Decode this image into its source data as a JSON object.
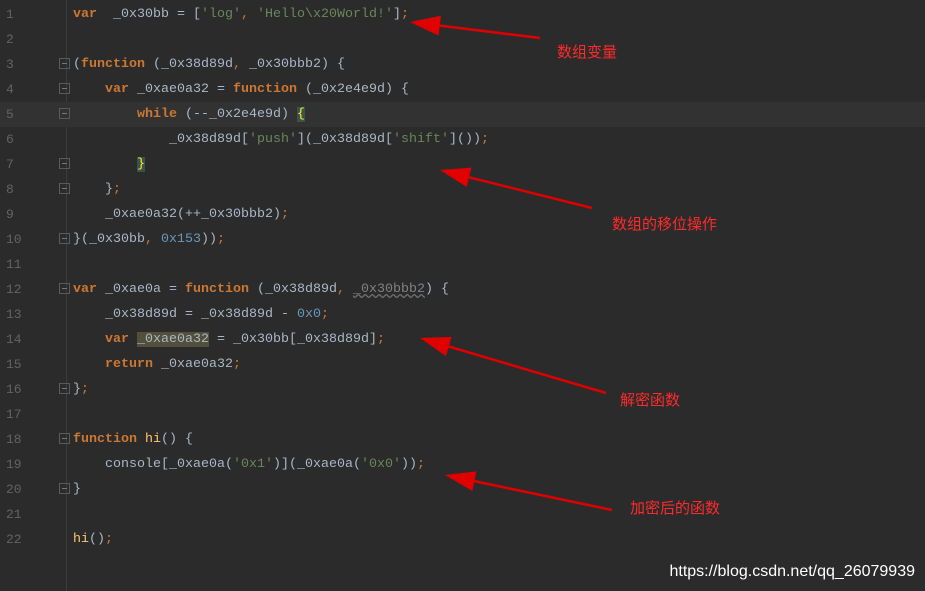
{
  "editor": {
    "current_line": 5,
    "lines": [
      {
        "n": "1",
        "indent": 0,
        "fold": false,
        "tokens": [
          [
            "kw",
            "var"
          ],
          [
            "",
            "  _0x30bb = ["
          ],
          [
            "str",
            "'log'"
          ],
          [
            "punc",
            ","
          ],
          [
            "",
            ""
          ],
          [
            "str",
            " 'Hello\\x20World!'"
          ],
          [
            "",
            "]"
          ],
          [
            "punc",
            ";"
          ]
        ]
      },
      {
        "n": "2",
        "indent": 0,
        "fold": false,
        "tokens": []
      },
      {
        "n": "3",
        "indent": 0,
        "fold": true,
        "tokens": [
          [
            "",
            "("
          ],
          [
            "kw",
            "function"
          ],
          [
            "",
            " (_0x38d89d"
          ],
          [
            "punc",
            ","
          ],
          [
            "",
            " _0x30bbb2) {"
          ]
        ]
      },
      {
        "n": "4",
        "indent": 4,
        "fold": true,
        "tokens": [
          [
            "kw",
            "var"
          ],
          [
            "",
            " _0xae0a32 = "
          ],
          [
            "kw",
            "function"
          ],
          [
            "",
            " (_0x2e4e9d) {"
          ]
        ]
      },
      {
        "n": "5",
        "indent": 8,
        "fold": true,
        "tokens": [
          [
            "kw",
            "while"
          ],
          [
            "",
            " (--_0x2e4e9d) "
          ],
          [
            "brace",
            "{"
          ]
        ]
      },
      {
        "n": "6",
        "indent": 12,
        "fold": false,
        "tokens": [
          [
            "",
            "_0x38d89d["
          ],
          [
            "str",
            "'push'"
          ],
          [
            "",
            "](_0x38d89d["
          ],
          [
            "str",
            "'shift'"
          ],
          [
            "",
            "]())"
          ],
          [
            "punc",
            ";"
          ]
        ]
      },
      {
        "n": "7",
        "indent": 8,
        "fold": true,
        "tokens": [
          [
            "brace",
            "}"
          ]
        ]
      },
      {
        "n": "8",
        "indent": 4,
        "fold": true,
        "tokens": [
          [
            "",
            "}"
          ],
          [
            "punc",
            ";"
          ]
        ]
      },
      {
        "n": "9",
        "indent": 4,
        "fold": false,
        "tokens": [
          [
            "",
            "_0xae0a32(++_0x30bbb2)"
          ],
          [
            "punc",
            ";"
          ]
        ]
      },
      {
        "n": "10",
        "indent": 0,
        "fold": true,
        "tokens": [
          [
            "",
            "}(_0x30bb"
          ],
          [
            "punc",
            ","
          ],
          [
            "num",
            " 0x153"
          ],
          [
            "",
            "))"
          ],
          [
            "punc",
            ";"
          ]
        ]
      },
      {
        "n": "11",
        "indent": 0,
        "fold": false,
        "tokens": []
      },
      {
        "n": "12",
        "indent": 0,
        "fold": true,
        "tokens": [
          [
            "kw",
            "var"
          ],
          [
            "",
            " _0xae0a = "
          ],
          [
            "kw",
            "function"
          ],
          [
            "",
            " (_0x38d89d"
          ],
          [
            "punc",
            ","
          ],
          [
            "",
            " "
          ],
          [
            "warn",
            "_0x30bbb2"
          ],
          [
            "",
            ") {"
          ]
        ]
      },
      {
        "n": "13",
        "indent": 4,
        "fold": false,
        "tokens": [
          [
            "",
            "_0x38d89d = _0x38d89d - "
          ],
          [
            "num",
            "0x0"
          ],
          [
            "punc",
            ";"
          ]
        ]
      },
      {
        "n": "14",
        "indent": 4,
        "fold": false,
        "tokens": [
          [
            "kw",
            "var"
          ],
          [
            "",
            " "
          ],
          [
            "hl",
            "_0xae0a32"
          ],
          [
            "",
            " = _0x30bb[_0x38d89d]"
          ],
          [
            "punc",
            ";"
          ]
        ]
      },
      {
        "n": "15",
        "indent": 4,
        "fold": false,
        "tokens": [
          [
            "kw",
            "return"
          ],
          [
            "",
            " _0xae0a32"
          ],
          [
            "punc",
            ";"
          ]
        ]
      },
      {
        "n": "16",
        "indent": 0,
        "fold": true,
        "tokens": [
          [
            "",
            "}"
          ],
          [
            "punc",
            ";"
          ]
        ]
      },
      {
        "n": "17",
        "indent": 0,
        "fold": false,
        "tokens": []
      },
      {
        "n": "18",
        "indent": 0,
        "fold": true,
        "tokens": [
          [
            "kw",
            "function"
          ],
          [
            "fn",
            " hi"
          ],
          [
            "",
            "() {"
          ]
        ]
      },
      {
        "n": "19",
        "indent": 4,
        "fold": false,
        "tokens": [
          [
            "",
            "console[_0xae0a("
          ],
          [
            "str",
            "'0x1'"
          ],
          [
            "",
            ")](_0xae0a("
          ],
          [
            "str",
            "'0x0'"
          ],
          [
            "",
            "))"
          ],
          [
            "punc",
            ";"
          ]
        ]
      },
      {
        "n": "20",
        "indent": 0,
        "fold": true,
        "tokens": [
          [
            "",
            "}"
          ]
        ]
      },
      {
        "n": "21",
        "indent": 0,
        "fold": false,
        "tokens": []
      },
      {
        "n": "22",
        "indent": 0,
        "fold": false,
        "tokens": [
          [
            "fn",
            "hi"
          ],
          [
            "",
            "()"
          ],
          [
            "punc",
            ";"
          ]
        ]
      }
    ]
  },
  "annotations": [
    {
      "text": "数组变量",
      "line": 1
    },
    {
      "text": "数组的移位操作",
      "line": 7
    },
    {
      "text": "解密函数",
      "line": 14
    },
    {
      "text": "加密后的函数",
      "line": 19
    }
  ],
  "colors": {
    "background": "#2b2b2b",
    "keyword": "#cc7832",
    "string": "#6a8759",
    "number": "#6897bb",
    "text": "#a9b7c6",
    "annotation": "#ff2a2a"
  },
  "watermark": "https://blog.csdn.net/qq_26079939"
}
